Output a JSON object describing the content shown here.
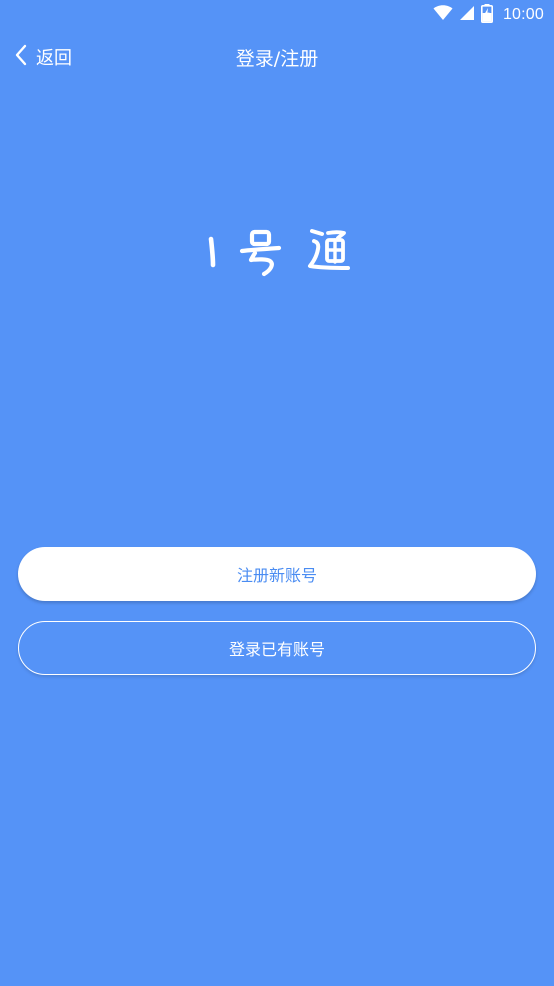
{
  "status_bar": {
    "time": "10:00",
    "icons": [
      "wifi-icon",
      "signal-icon",
      "battery-charging-icon"
    ]
  },
  "nav": {
    "back_label": "返回",
    "back_icon": "chevron-left-icon",
    "title": "登录/注册"
  },
  "logo": {
    "text": "1号通"
  },
  "actions": {
    "register_label": "注册新账号",
    "login_label": "登录已有账号"
  },
  "colors": {
    "background": "#5593F7",
    "accent_text": "#4A8CF2",
    "foreground": "#FFFFFF"
  }
}
